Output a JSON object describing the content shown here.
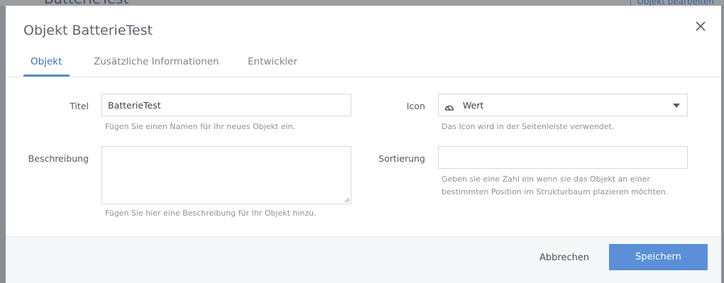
{
  "background": {
    "page_title": "BatterieTest",
    "action_link": "Objekt bearbeiten"
  },
  "modal": {
    "title": "Objekt BatterieTest",
    "close_icon": "close-icon"
  },
  "tabs": [
    {
      "label": "Objekt",
      "active": true
    },
    {
      "label": "Zusätzliche Informationen",
      "active": false
    },
    {
      "label": "Entwickler",
      "active": false
    }
  ],
  "form": {
    "title": {
      "label": "Titel",
      "value": "BatterieTest",
      "help": "Fügen Sie einen Namen für Ihr neues Objekt ein."
    },
    "description": {
      "label": "Beschreibung",
      "value": "",
      "help": "Fügen Sie hier eine Beschreibung für Ihr Objekt hinzu."
    },
    "icon": {
      "label": "Icon",
      "selected_icon": "gauge-icon",
      "value": "Wert",
      "help": "Das Icon wird in der Seitenleiste verwendet."
    },
    "sort": {
      "label": "Sortierung",
      "value": "",
      "help": "Geben sie eine Zahl ein wenn sie das Objekt an einer bestimmten Position im Strukturbaum plazieren möchten."
    }
  },
  "footer": {
    "cancel_label": "Abbrechen",
    "save_label": "Speichern"
  },
  "colors": {
    "accent": "#5b8fd8",
    "active_tab": "#3d6db0",
    "overlay": "#8a8e93"
  }
}
